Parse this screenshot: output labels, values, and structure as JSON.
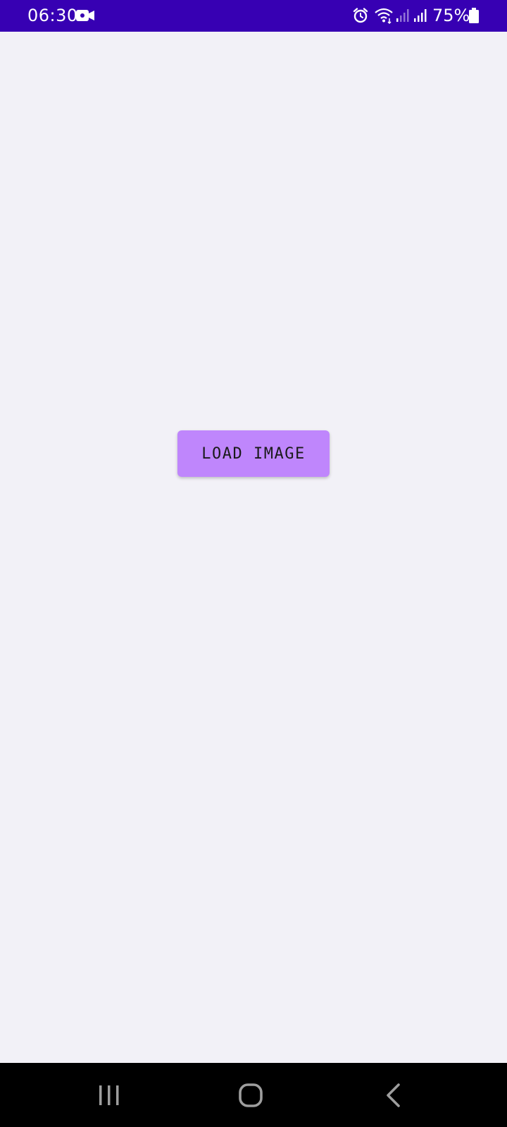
{
  "status_bar": {
    "time": "06:30",
    "battery_percent": "75%",
    "background_color": "#3700b3",
    "icons": [
      "camera-icon",
      "alarm-icon",
      "wifi-icon",
      "signal-icon",
      "signal-icon",
      "battery-icon"
    ]
  },
  "main": {
    "button_label": "LOAD IMAGE",
    "button_color": "#bf86fc",
    "background_color": "#f2f1f7"
  },
  "nav_bar": {
    "icons": [
      "recents-icon",
      "home-icon",
      "back-icon"
    ]
  }
}
